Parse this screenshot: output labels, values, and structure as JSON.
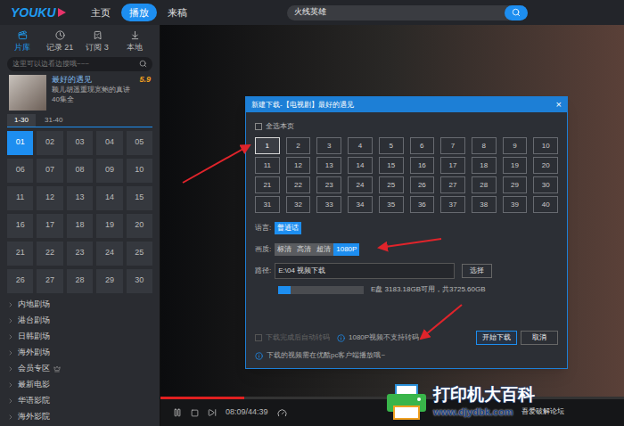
{
  "app": {
    "logo": "YOUKU",
    "nav": [
      {
        "label": "主页",
        "selected": false
      },
      {
        "label": "播放",
        "selected": true
      },
      {
        "label": "来稿",
        "selected": false
      }
    ],
    "search": {
      "value": "火线英雄"
    }
  },
  "sidebar": {
    "tabs": [
      {
        "label": "片库",
        "selected": true
      },
      {
        "label": "记录 21",
        "selected": false
      },
      {
        "label": "订阅 3",
        "selected": false
      },
      {
        "label": "本地",
        "selected": false
      }
    ],
    "search": {
      "placeholder": "这里可以边看边搜哦~~~"
    },
    "show": {
      "title": "最好的遇见",
      "score": "5.9",
      "description": "颖儿胡遥重现宽鲍的真讲",
      "episodes": "40集全"
    },
    "range_tabs": [
      {
        "label": "1-30",
        "selected": true
      },
      {
        "label": "31-40",
        "selected": false
      }
    ],
    "episodes": [
      {
        "label": "01",
        "selected": true
      },
      {
        "label": "02",
        "selected": false
      },
      {
        "label": "03",
        "selected": false
      },
      {
        "label": "04",
        "selected": false
      },
      {
        "label": "05",
        "selected": false
      },
      {
        "label": "06",
        "selected": false
      },
      {
        "label": "07",
        "selected": false
      },
      {
        "label": "08",
        "selected": false
      },
      {
        "label": "09",
        "selected": false
      },
      {
        "label": "10",
        "selected": false
      },
      {
        "label": "11",
        "selected": false
      },
      {
        "label": "12",
        "selected": false
      },
      {
        "label": "13",
        "selected": false
      },
      {
        "label": "14",
        "selected": false
      },
      {
        "label": "15",
        "selected": false
      },
      {
        "label": "16",
        "selected": false
      },
      {
        "label": "17",
        "selected": false
      },
      {
        "label": "18",
        "selected": false
      },
      {
        "label": "19",
        "selected": false
      },
      {
        "label": "20",
        "selected": false
      },
      {
        "label": "21",
        "selected": false
      },
      {
        "label": "22",
        "selected": false
      },
      {
        "label": "23",
        "selected": false
      },
      {
        "label": "24",
        "selected": false
      },
      {
        "label": "25",
        "selected": false
      },
      {
        "label": "26",
        "selected": false
      },
      {
        "label": "27",
        "selected": false
      },
      {
        "label": "28",
        "selected": false
      },
      {
        "label": "29",
        "selected": false
      },
      {
        "label": "30",
        "selected": false
      }
    ],
    "categories": [
      {
        "label": "内地剧场",
        "vip": false
      },
      {
        "label": "港台剧场",
        "vip": false
      },
      {
        "label": "日韩剧场",
        "vip": false
      },
      {
        "label": "海外剧场",
        "vip": false
      },
      {
        "label": "会员专区",
        "vip": true
      },
      {
        "label": "最新电影",
        "vip": false
      },
      {
        "label": "华语影院",
        "vip": false
      },
      {
        "label": "海外影院",
        "vip": false
      }
    ]
  },
  "player": {
    "progress": 0.18,
    "time": "08:09/44:39"
  },
  "dialog": {
    "title": "新建下载-【电视剧】最好的遇见",
    "close": "×",
    "select_all": {
      "label": "全选本页",
      "checked": false
    },
    "episodes": [
      {
        "label": "1",
        "selected": true
      },
      {
        "label": "2",
        "selected": false
      },
      {
        "label": "3",
        "selected": false
      },
      {
        "label": "4",
        "selected": false
      },
      {
        "label": "5",
        "selected": false
      },
      {
        "label": "6",
        "selected": false
      },
      {
        "label": "7",
        "selected": false
      },
      {
        "label": "8",
        "selected": false
      },
      {
        "label": "9",
        "selected": false
      },
      {
        "label": "10",
        "selected": false
      },
      {
        "label": "11",
        "selected": false
      },
      {
        "label": "12",
        "selected": false
      },
      {
        "label": "13",
        "selected": false
      },
      {
        "label": "14",
        "selected": false
      },
      {
        "label": "15",
        "selected": false
      },
      {
        "label": "16",
        "selected": false
      },
      {
        "label": "17",
        "selected": false
      },
      {
        "label": "18",
        "selected": false
      },
      {
        "label": "19",
        "selected": false
      },
      {
        "label": "20",
        "selected": false
      },
      {
        "label": "21",
        "selected": false
      },
      {
        "label": "22",
        "selected": false
      },
      {
        "label": "23",
        "selected": false
      },
      {
        "label": "24",
        "selected": false
      },
      {
        "label": "25",
        "selected": false
      },
      {
        "label": "26",
        "selected": false
      },
      {
        "label": "27",
        "selected": false
      },
      {
        "label": "28",
        "selected": false
      },
      {
        "label": "29",
        "selected": false
      },
      {
        "label": "30",
        "selected": false
      },
      {
        "label": "31",
        "selected": false
      },
      {
        "label": "32",
        "selected": false
      },
      {
        "label": "33",
        "selected": false
      },
      {
        "label": "34",
        "selected": false
      },
      {
        "label": "35",
        "selected": false
      },
      {
        "label": "36",
        "selected": false
      },
      {
        "label": "37",
        "selected": false
      },
      {
        "label": "38",
        "selected": false
      },
      {
        "label": "39",
        "selected": false
      },
      {
        "label": "40",
        "selected": false
      }
    ],
    "language": {
      "label": "语言:",
      "options": [
        {
          "label": "普通话",
          "selected": true
        }
      ]
    },
    "quality": {
      "label": "画质:",
      "options": [
        {
          "label": "标清",
          "selected": false
        },
        {
          "label": "高清",
          "selected": false
        },
        {
          "label": "超清",
          "selected": false
        },
        {
          "label": "1080P",
          "selected": true
        }
      ]
    },
    "path": {
      "label": "路径:",
      "value": "E:\\04 视频下载",
      "button": "选择"
    },
    "disk": {
      "level": 0.15,
      "reading": "E盘 3183.18GB可用，共3725.60GB"
    },
    "transcode": {
      "label": "下载完成后自动转码",
      "checked": false,
      "disabled": true,
      "note": "1080P视频不支持转码"
    },
    "buttons": [
      {
        "label": "开始下载",
        "primary": true
      },
      {
        "label": "取消",
        "primary": false
      }
    ],
    "footer": "下载的视频需在优酷pc客户端播放哦~"
  },
  "watermark": {
    "title": "打印机大百科",
    "url": "www.djydbk.com",
    "forum": "吾爱破解论坛"
  }
}
